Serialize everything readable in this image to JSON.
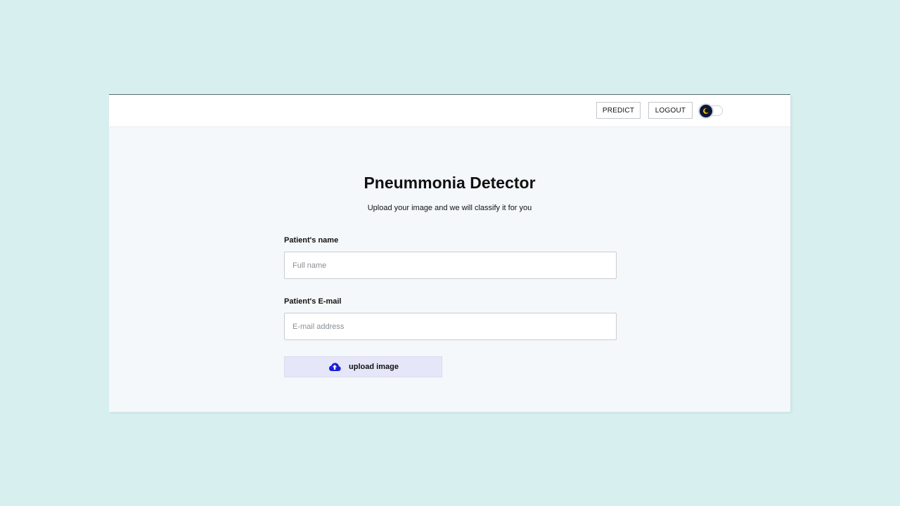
{
  "navbar": {
    "predict_label": "PREDICT",
    "logout_label": "LOGOUT",
    "theme_toggle_icon": "moon-icon"
  },
  "main": {
    "title": "Pneummonia Detector",
    "subtitle": "Upload your image and we will classify it for you"
  },
  "form": {
    "name_label": "Patient's name",
    "name_placeholder": "Full name",
    "name_value": "",
    "email_label": "Patient's E-mail",
    "email_placeholder": "E-mail address",
    "email_value": "",
    "upload_label": "upload image",
    "upload_icon": "cloud-upload-icon"
  },
  "colors": {
    "page_background": "#d8eff0",
    "upload_button_bg": "#e5e6f8",
    "upload_icon": "#1a1fd6",
    "toggle_knob": "#0e1633",
    "moon": "#f4c20d"
  }
}
